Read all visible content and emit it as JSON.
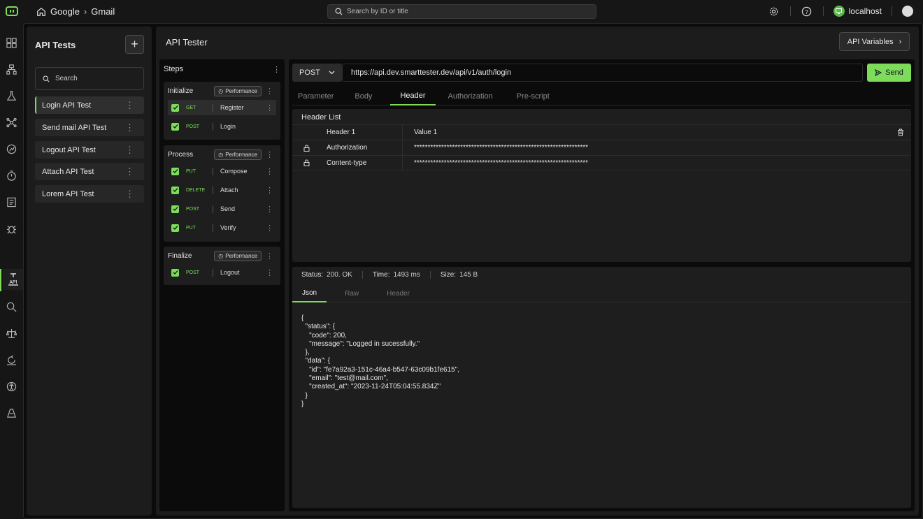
{
  "colors": {
    "accent": "#7ddc5a",
    "background": "#121212"
  },
  "topbar": {
    "breadcrumb": [
      "Google",
      "Gmail"
    ],
    "search_placeholder": "Search by ID or title",
    "host": "localhost"
  },
  "sidebar": {
    "icons": [
      "dashboard-icon",
      "hierarchy-icon",
      "flask-icon",
      "network-icon",
      "run-icon",
      "timer-icon",
      "report-icon",
      "bug-icon",
      "api-icon",
      "search-zoom-icon",
      "scale-icon",
      "cycle-icon",
      "accessibility-icon",
      "security-icon"
    ],
    "api_label": "API"
  },
  "tests_panel": {
    "title": "API Tests",
    "add_label": "+",
    "search_placeholder": "Search",
    "items": [
      {
        "label": "Login API Test"
      },
      {
        "label": "Send mail API Test"
      },
      {
        "label": "Logout API Test"
      },
      {
        "label": "Attach API Test"
      },
      {
        "label": "Lorem API Test"
      }
    ]
  },
  "main": {
    "title": "API Tester",
    "variables_label": "API Variables"
  },
  "steps": {
    "title": "Steps",
    "perf_label": "Performance",
    "groups": [
      {
        "name": "Initialize",
        "steps": [
          {
            "method": "GET",
            "name": "Register"
          },
          {
            "method": "POST",
            "name": "Login"
          }
        ]
      },
      {
        "name": "Process",
        "steps": [
          {
            "method": "PUT",
            "name": "Compose"
          },
          {
            "method": "DELETE",
            "name": "Attach"
          },
          {
            "method": "POST",
            "name": "Send"
          },
          {
            "method": "PUT",
            "name": "Verify"
          }
        ]
      },
      {
        "name": "Finalize",
        "steps": [
          {
            "method": "POST",
            "name": "Logout"
          }
        ]
      }
    ]
  },
  "request": {
    "method": "POST",
    "url": "https://api.dev.smarttester.dev/api/v1/auth/login",
    "send_label": "Send",
    "tabs": [
      "Parameter",
      "Body",
      "Header",
      "Authorization",
      "Pre-script"
    ],
    "active_tab": "Header"
  },
  "headers": {
    "title": "Header List",
    "rows": [
      {
        "key": "Header 1",
        "value": "Value 1"
      },
      {
        "key": "Authorization",
        "value": "****************************************************************"
      },
      {
        "key": "Content-type",
        "value": "****************************************************************"
      }
    ]
  },
  "response": {
    "status_label": "Status:",
    "status": "200. OK",
    "time_label": "Time:",
    "time": "1493 ms",
    "size_label": "Size:",
    "size": "145 B",
    "tabs": [
      "Json",
      "Raw",
      "Header"
    ],
    "active_tab": "Json",
    "body": "{\n  \"status\": {\n    \"code\": 200,\n    \"message\": \"Logged in sucessfully.\"\n  },\n  \"data\": {\n    \"id\": \"fe7a92a3-151c-46a4-b547-63c09b1fe615\",\n    \"email\": \"test@mail.com\",\n    \"created_at\": \"2023-11-24T05:04:55.834Z\"\n  }\n}"
  }
}
